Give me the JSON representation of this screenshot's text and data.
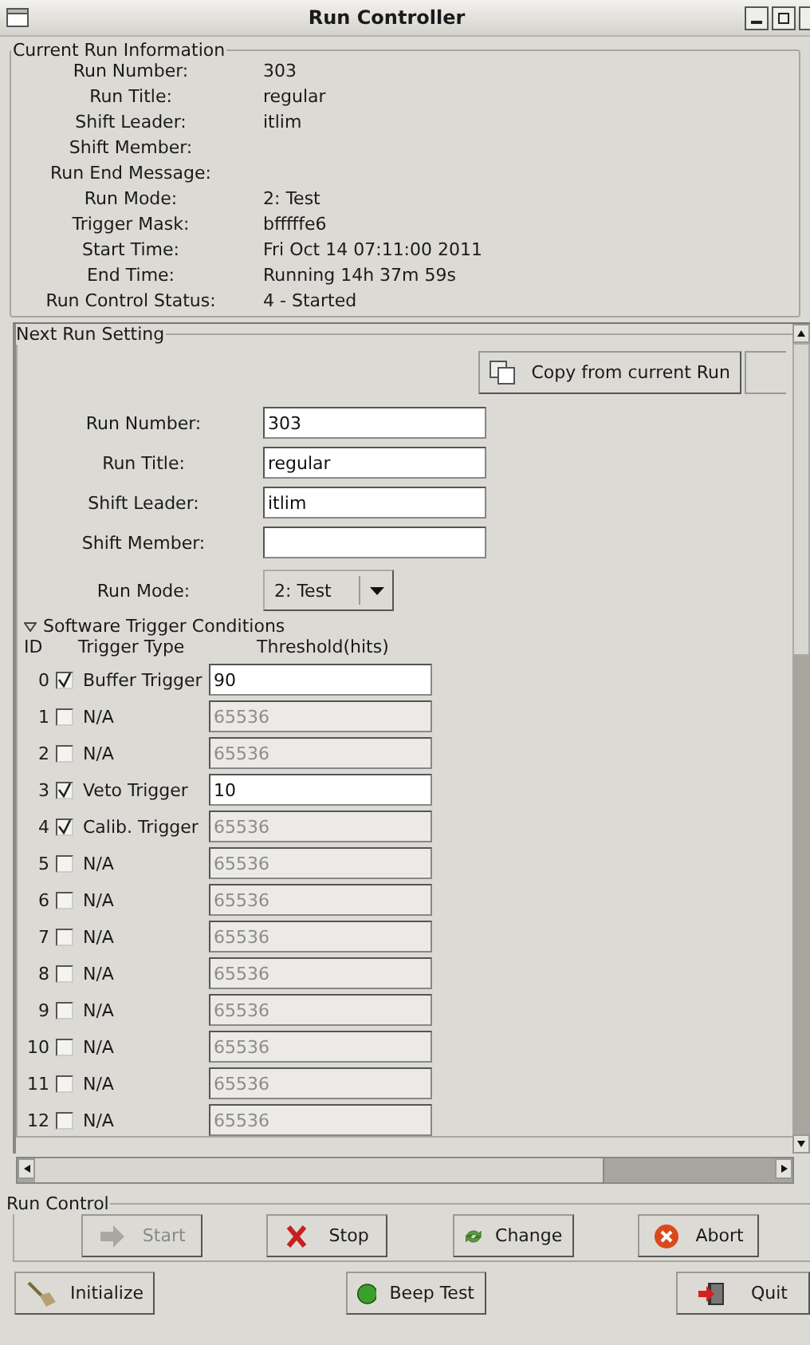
{
  "window": {
    "title": "Run Controller"
  },
  "current_run": {
    "title": "Current Run Information",
    "rows": [
      {
        "label": "Run Number:",
        "value": "303"
      },
      {
        "label": "Run Title:",
        "value": "regular"
      },
      {
        "label": "Shift Leader:",
        "value": "itlim"
      },
      {
        "label": "Shift Member:"
      },
      {
        "label": "Run End Message:"
      },
      {
        "label": "Run Mode:",
        "value": "2: Test"
      },
      {
        "label": "Trigger Mask:",
        "value": "bfffffe6"
      },
      {
        "label": "Start Time:",
        "value": "Fri Oct 14 07:11:00 2011"
      },
      {
        "label": "End Time:",
        "value": "Running 14h 37m 59s"
      },
      {
        "label": "Run Control Status:",
        "value": "4 - Started"
      }
    ]
  },
  "next_run": {
    "title": "Next Run Setting",
    "copy_button": "Copy from current Run",
    "fields": [
      {
        "label": "Run Number:",
        "value": "303"
      },
      {
        "label": "Run Title:",
        "value": "regular"
      },
      {
        "label": "Shift Leader:",
        "value": "itlim"
      },
      {
        "label": "Shift Member:"
      }
    ],
    "run_mode": {
      "label": "Run Mode:",
      "value": "2: Test"
    },
    "triggers": {
      "title": "Software Trigger Conditions",
      "expanded": true,
      "columns": [
        "ID",
        "Trigger Type",
        "Threshold(hits)"
      ],
      "rows": [
        {
          "id": "0",
          "type": "Buffer Trigger",
          "checked": true,
          "threshold": "90",
          "disabled": false
        },
        {
          "id": "1",
          "type": "N/A",
          "checked": false,
          "threshold": "65536",
          "disabled": true
        },
        {
          "id": "2",
          "type": "N/A",
          "checked": false,
          "threshold": "65536",
          "disabled": true
        },
        {
          "id": "3",
          "type": "Veto Trigger",
          "checked": true,
          "threshold": "10",
          "disabled": false
        },
        {
          "id": "4",
          "type": "Calib. Trigger",
          "checked": true,
          "threshold": "65536",
          "disabled": true
        },
        {
          "id": "5",
          "type": "N/A",
          "checked": false,
          "threshold": "65536",
          "disabled": true
        },
        {
          "id": "6",
          "type": "N/A",
          "checked": false,
          "threshold": "65536",
          "disabled": true
        },
        {
          "id": "7",
          "type": "N/A",
          "checked": false,
          "threshold": "65536",
          "disabled": true
        },
        {
          "id": "8",
          "type": "N/A",
          "checked": false,
          "threshold": "65536",
          "disabled": true
        },
        {
          "id": "9",
          "type": "N/A",
          "checked": false,
          "threshold": "65536",
          "disabled": true
        },
        {
          "id": "10",
          "type": "N/A",
          "checked": false,
          "threshold": "65536",
          "disabled": true
        },
        {
          "id": "11",
          "type": "N/A",
          "checked": false,
          "threshold": "65536",
          "disabled": true
        },
        {
          "id": "12",
          "type": "N/A",
          "checked": false,
          "threshold": "65536",
          "disabled": true
        }
      ]
    }
  },
  "run_control": {
    "title": "Run Control",
    "buttons": [
      {
        "label": "Start",
        "kind": "start",
        "disabled": true
      },
      {
        "label": "Stop",
        "kind": "stop",
        "disabled": false
      },
      {
        "label": "Change",
        "kind": "change",
        "disabled": false
      },
      {
        "label": "Abort",
        "kind": "abort",
        "disabled": false
      }
    ]
  },
  "bottom_buttons": [
    {
      "label": "Initialize",
      "kind": "initialize"
    },
    {
      "label": "Beep Test",
      "kind": "beep"
    },
    {
      "label": "Quit",
      "kind": "quit"
    }
  ]
}
